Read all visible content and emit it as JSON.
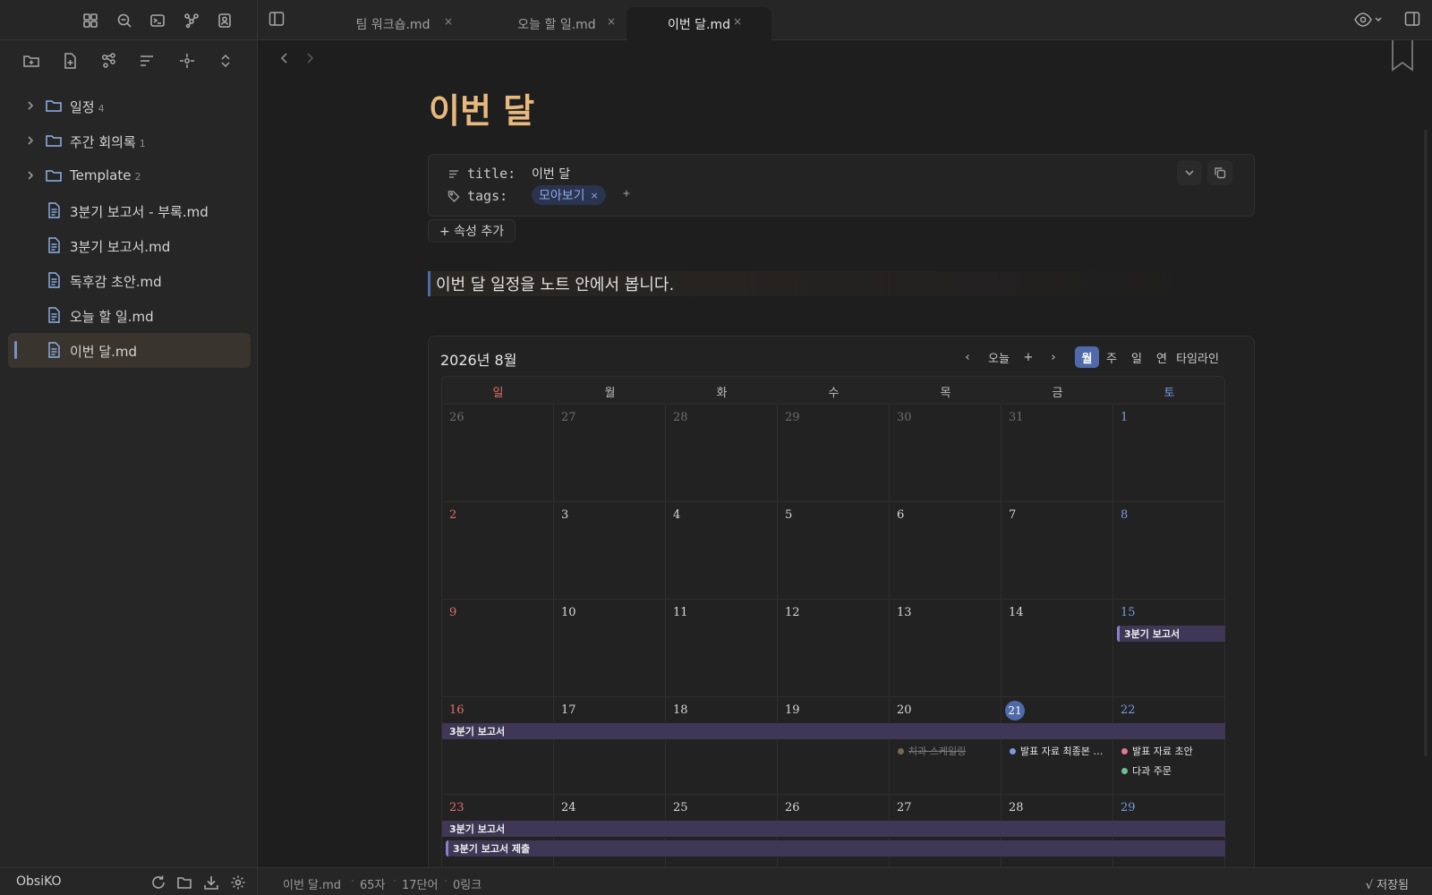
{
  "app": {
    "vault_name": "ObsiKO"
  },
  "tabs": [
    {
      "label": "팀 워크숍.md",
      "close": "×",
      "active": false
    },
    {
      "label": "오늘 할 일.md",
      "close": "×",
      "active": false
    },
    {
      "label": "이번 달.md",
      "close": "×",
      "active": true
    }
  ],
  "ribbon_icons": [
    "dashboard-icon",
    "search-icon",
    "terminal-icon",
    "graph-icon",
    "profile-icon"
  ],
  "file_toolbar_icons": [
    "new-folder-icon",
    "new-note-icon",
    "graph-view-icon",
    "sort-icon",
    "reveal-icon",
    "collapse-icon"
  ],
  "tree": [
    {
      "type": "folder",
      "label": "일정",
      "count": "4"
    },
    {
      "type": "folder",
      "label": "주간 회의록",
      "count": "1"
    },
    {
      "type": "folder",
      "label": "Template",
      "count": "2"
    },
    {
      "type": "file",
      "label": "3분기 보고서 - 부록.md"
    },
    {
      "type": "file",
      "label": "3분기 보고서.md"
    },
    {
      "type": "file",
      "label": "독후감 초안.md"
    },
    {
      "type": "file",
      "label": "오늘 할 일.md"
    },
    {
      "type": "file",
      "label": "이번 달.md",
      "active": true
    }
  ],
  "note": {
    "title": "이번 달",
    "properties": {
      "title_key": "title:",
      "title_value": "이번 달",
      "tags_key": "tags:",
      "tag": "모아보기",
      "tag_remove": "×",
      "tag_add": "+"
    },
    "add_property": "+ 속성 추가",
    "callout_text": "이번 달 일정을 노트 안에서 봅니다."
  },
  "calendar": {
    "title": "2026년 8월",
    "nav": {
      "prev": "‹",
      "today": "오늘",
      "add": "+",
      "next": "›"
    },
    "views": [
      {
        "label": "월",
        "selected": true
      },
      {
        "label": "주",
        "selected": false
      },
      {
        "label": "일",
        "selected": false
      },
      {
        "label": "연",
        "selected": false
      },
      {
        "label": "타임라인",
        "selected": false
      }
    ],
    "weekdays": [
      "일",
      "월",
      "화",
      "수",
      "목",
      "금",
      "토"
    ],
    "weeks": [
      [
        "26",
        "27",
        "28",
        "29",
        "30",
        "31",
        "1"
      ],
      [
        "2",
        "3",
        "4",
        "5",
        "6",
        "7",
        "8"
      ],
      [
        "9",
        "10",
        "11",
        "12",
        "13",
        "14",
        "15"
      ],
      [
        "16",
        "17",
        "18",
        "19",
        "20",
        "21",
        "22"
      ],
      [
        "23",
        "24",
        "25",
        "26",
        "27",
        "28",
        "29"
      ]
    ],
    "today": "21",
    "events": {
      "report_w3": "3분기 보고서",
      "report_w4": "3분기 보고서",
      "report_w5": "3분기 보고서",
      "submit_w5": "3분기 보고서 제출",
      "dental": "치과 스케일링",
      "final_slides": "발표 자료 최종본 …",
      "draft_slides": "발표 자료 초안",
      "tea": "다과 주문"
    },
    "event_colors": {
      "report": "#3e3856",
      "report_accent": "#8a7fd0",
      "dental": "#6f6a50",
      "final_slides": "#7b9ae0",
      "draft_slides": "#e07a8f",
      "tea": "#6fbf95"
    }
  },
  "status": {
    "file": "이번 달.md",
    "chars": "65자",
    "words": "17단어",
    "links": "0링크",
    "saved": "√ 저장됨"
  }
}
